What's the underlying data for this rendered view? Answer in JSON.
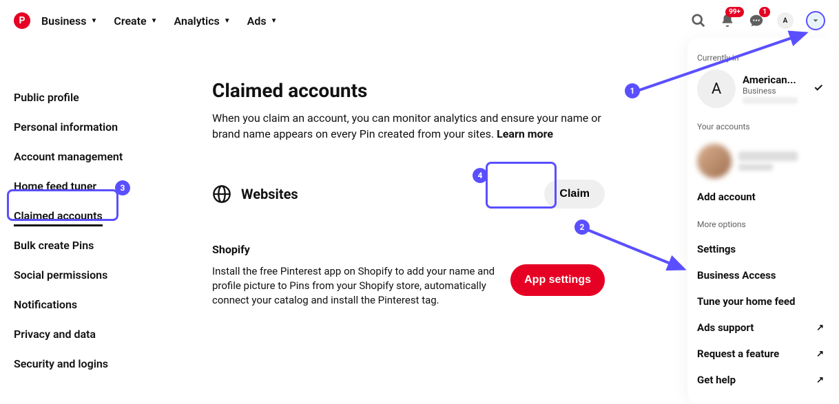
{
  "header": {
    "nav": [
      "Business",
      "Create",
      "Analytics",
      "Ads"
    ],
    "notif_badge": "99+",
    "msg_badge": "1",
    "avatar_letter": "A"
  },
  "sidebar": {
    "items": [
      "Public profile",
      "Personal information",
      "Account management",
      "Home feed tuner",
      "Claimed accounts",
      "Bulk create Pins",
      "Social permissions",
      "Notifications",
      "Privacy and data",
      "Security and logins"
    ],
    "active_index": 4
  },
  "main": {
    "title": "Claimed accounts",
    "desc": "When you claim an account, you can monitor analytics and ensure your name or brand name appears on every Pin created from your sites. ",
    "learn_more": "Learn more",
    "websites_label": "Websites",
    "claim_btn": "Claim",
    "shopify_title": "Shopify",
    "shopify_desc": "Install the free Pinterest app on Shopify to add your name and profile picture to Pins from your Shopify store, automatically connect your catalog and install the Pinterest tag.",
    "app_settings_btn": "App settings"
  },
  "panel": {
    "currently_in": "Currently in",
    "acct_name": "American...",
    "acct_type": "Business",
    "acct_avatar": "A",
    "your_accounts": "Your accounts",
    "add_account": "Add account",
    "more_options": "More options",
    "items": [
      {
        "label": "Settings",
        "ext": false
      },
      {
        "label": "Business Access",
        "ext": false
      },
      {
        "label": "Tune your home feed",
        "ext": false
      },
      {
        "label": "Ads support",
        "ext": true
      },
      {
        "label": "Request a feature",
        "ext": true
      },
      {
        "label": "Get help",
        "ext": true
      }
    ]
  },
  "callouts": {
    "c1": "1",
    "c2": "2",
    "c3": "3",
    "c4": "4"
  }
}
